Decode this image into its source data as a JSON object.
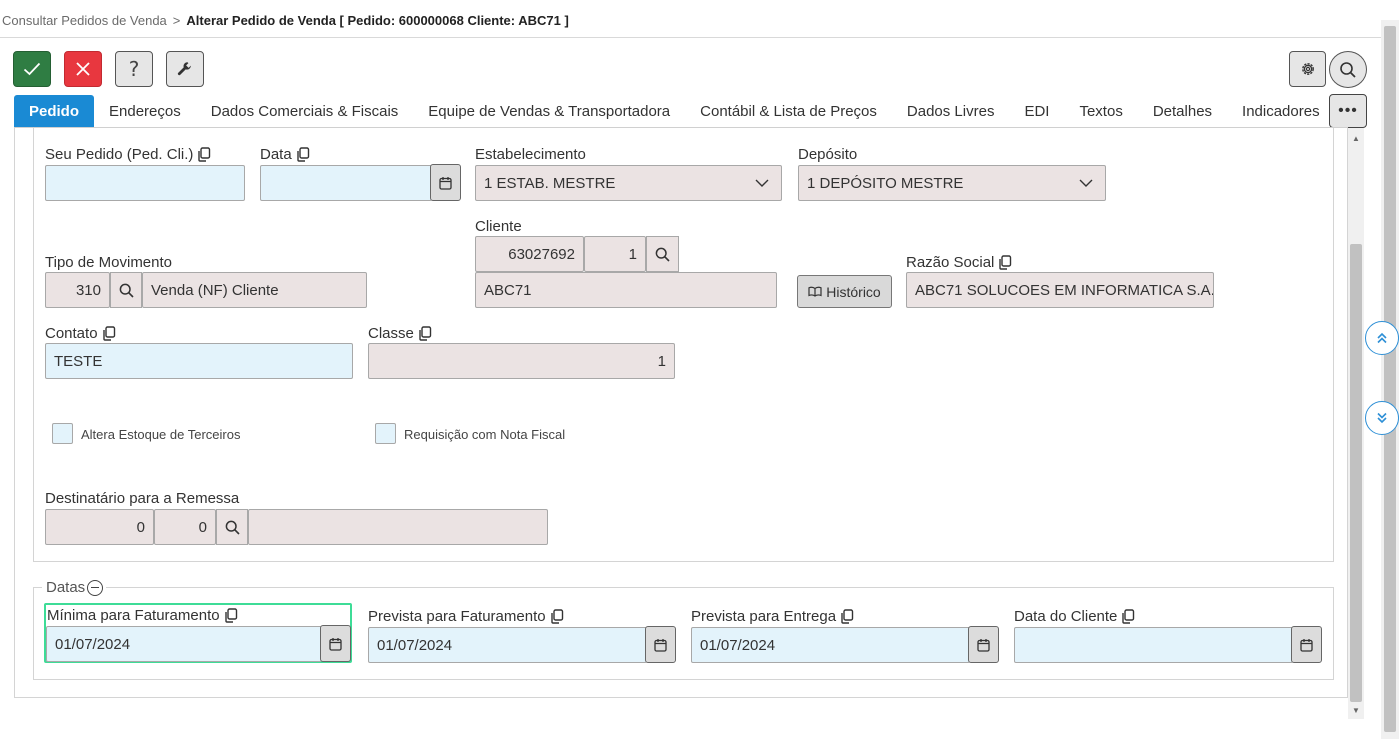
{
  "breadcrumb": {
    "parent": "Consultar Pedidos de Venda",
    "separator": ">",
    "current": "Alterar Pedido de Venda [ Pedido: 600000068 Cliente: ABC71 ]"
  },
  "toolbar": {
    "confirm_icon": "check-icon",
    "cancel_icon": "close-icon",
    "help_label": "?",
    "tools_icon": "wrench-icon",
    "settings_icon": "gear-icon",
    "search_icon": "search-icon"
  },
  "tabs": [
    {
      "label": "Pedido",
      "active": true
    },
    {
      "label": "Endereços"
    },
    {
      "label": "Dados Comerciais & Fiscais"
    },
    {
      "label": "Equipe de Vendas & Transportadora"
    },
    {
      "label": "Contábil & Lista de Preços"
    },
    {
      "label": "Dados Livres"
    },
    {
      "label": "EDI"
    },
    {
      "label": "Textos"
    },
    {
      "label": "Detalhes"
    },
    {
      "label": "Indicadores"
    }
  ],
  "tabs_more_label": "•••",
  "form": {
    "seu_pedido": {
      "label": "Seu Pedido (Ped. Cli.)",
      "value": ""
    },
    "data": {
      "label": "Data",
      "value": ""
    },
    "estabelecimento": {
      "label": "Estabelecimento",
      "value": "1 ESTAB. MESTRE"
    },
    "deposito": {
      "label": "Depósito",
      "value": "1 DEPÓSITO MESTRE"
    },
    "cliente": {
      "label": "Cliente",
      "code": "63027692",
      "seq": "1",
      "name": "ABC71"
    },
    "tipo_movimento": {
      "label": "Tipo de Movimento",
      "code": "310",
      "desc": "Venda (NF) Cliente"
    },
    "historico_label": "Histórico",
    "razao_social": {
      "label": "Razão Social",
      "value": "ABC71 SOLUCOES EM INFORMATICA S.A."
    },
    "contato": {
      "label": "Contato",
      "value": "TESTE"
    },
    "classe": {
      "label": "Classe",
      "value": "1"
    },
    "altera_estoque": {
      "label": "Altera Estoque de Terceiros",
      "checked": false
    },
    "requisicao_nf": {
      "label": "Requisição com Nota Fiscal",
      "checked": false
    },
    "destinatario": {
      "label": "Destinatário para a Remessa",
      "code1": "0",
      "code2": "0",
      "name": ""
    }
  },
  "datas": {
    "legend": "Datas",
    "minima_faturamento": {
      "label": "Mínima para Faturamento",
      "value": "01/07/2024"
    },
    "prevista_faturamento": {
      "label": "Prevista para Faturamento",
      "value": "01/07/2024"
    },
    "prevista_entrega": {
      "label": "Prevista para Entrega",
      "value": "01/07/2024"
    },
    "data_cliente": {
      "label": "Data do Cliente",
      "value": ""
    }
  },
  "colors": {
    "accent": "#1a8ad4",
    "confirm": "#2f7d43",
    "cancel": "#e8373f",
    "editable_bg": "#e3f3fb",
    "readonly_bg": "#ebe3e3",
    "focus": "#3ddc97"
  }
}
